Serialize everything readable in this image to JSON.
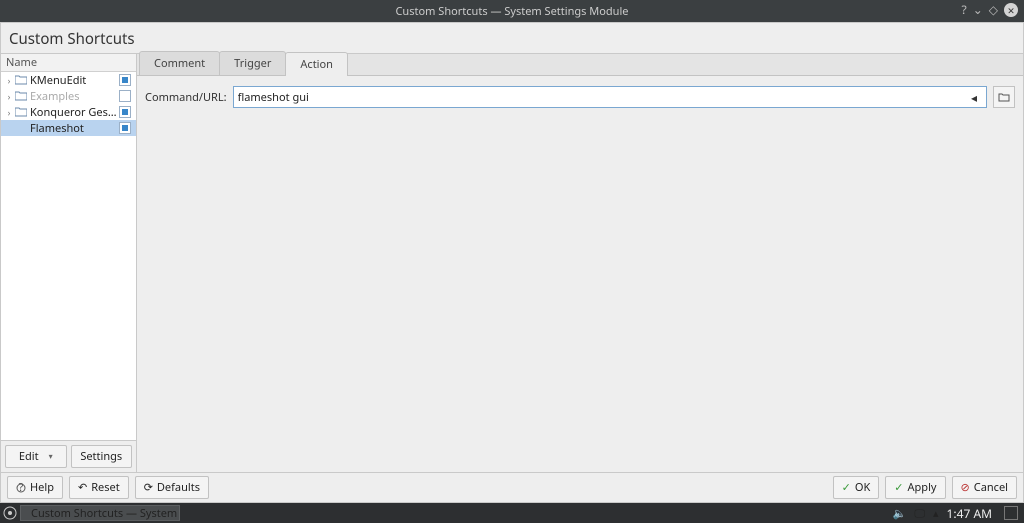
{
  "titlebar": {
    "title": "Custom Shortcuts — System Settings Module"
  },
  "header": {
    "title": "Custom Shortcuts"
  },
  "tree": {
    "header": "Name",
    "items": [
      {
        "label": "KMenuEdit",
        "expandable": true,
        "icon": "folder",
        "checked": true,
        "disabled": false
      },
      {
        "label": "Examples",
        "expandable": true,
        "icon": "folder",
        "checked": false,
        "disabled": true
      },
      {
        "label": "Konqueror Gestures",
        "expandable": true,
        "icon": "folder",
        "checked": true,
        "disabled": false
      },
      {
        "label": "Flameshot",
        "expandable": false,
        "icon": "none",
        "checked": true,
        "disabled": false,
        "selected": true
      }
    ]
  },
  "sidebarButtons": {
    "edit": "Edit",
    "settings": "Settings"
  },
  "tabs": {
    "items": [
      "Comment",
      "Trigger",
      "Action"
    ],
    "activeIndex": 2
  },
  "form": {
    "commandLabel": "Command/URL:",
    "commandValue": "flameshot gui"
  },
  "footer": {
    "help": "Help",
    "reset": "Reset",
    "defaults": "Defaults",
    "ok": "OK",
    "apply": "Apply",
    "cancel": "Cancel"
  },
  "taskbar": {
    "task": "Custom Shortcuts — System Setti...",
    "clock": "1:47 AM"
  }
}
